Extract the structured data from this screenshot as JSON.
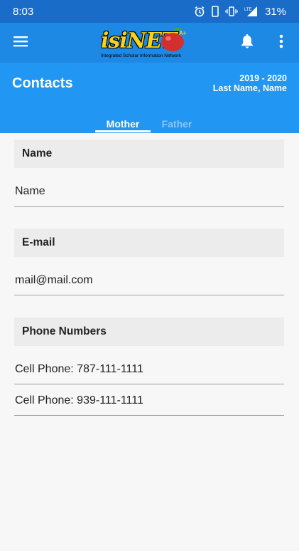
{
  "status_bar": {
    "time": "8:03",
    "network": "LTE",
    "battery": "31%"
  },
  "app_bar": {
    "logo": {
      "wordmark": "isiNET",
      "tagline": "Integrated Scholar Information Network"
    },
    "icons": {
      "menu": "hamburger-menu-icon",
      "notifications": "bell-icon",
      "overflow": "more-vertical-icon"
    }
  },
  "header": {
    "title": "Contacts",
    "school_year": "2019 - 2020",
    "student_name": "Last Name, Name"
  },
  "tabs": [
    {
      "label": "Mother",
      "selected": true
    },
    {
      "label": "Father",
      "selected": false
    }
  ],
  "sections": {
    "name": {
      "header": "Name",
      "value": "Name"
    },
    "email": {
      "header": "E-mail",
      "value": "mail@mail.com"
    },
    "phones": {
      "header": "Phone Numbers",
      "items": [
        "Cell Phone: 787-111-1111",
        "Cell Phone: 939-111-1111"
      ]
    }
  },
  "colors": {
    "status_bar": "#1a6cc9",
    "app_bar": "#1e88e5",
    "header": "#2196f3",
    "inactive_tab": "#8fc5f5",
    "background": "#f7f7f7",
    "section_header": "#ececec",
    "logo_yellow": "#f7d21b",
    "apple_red": "#d32f2f"
  }
}
